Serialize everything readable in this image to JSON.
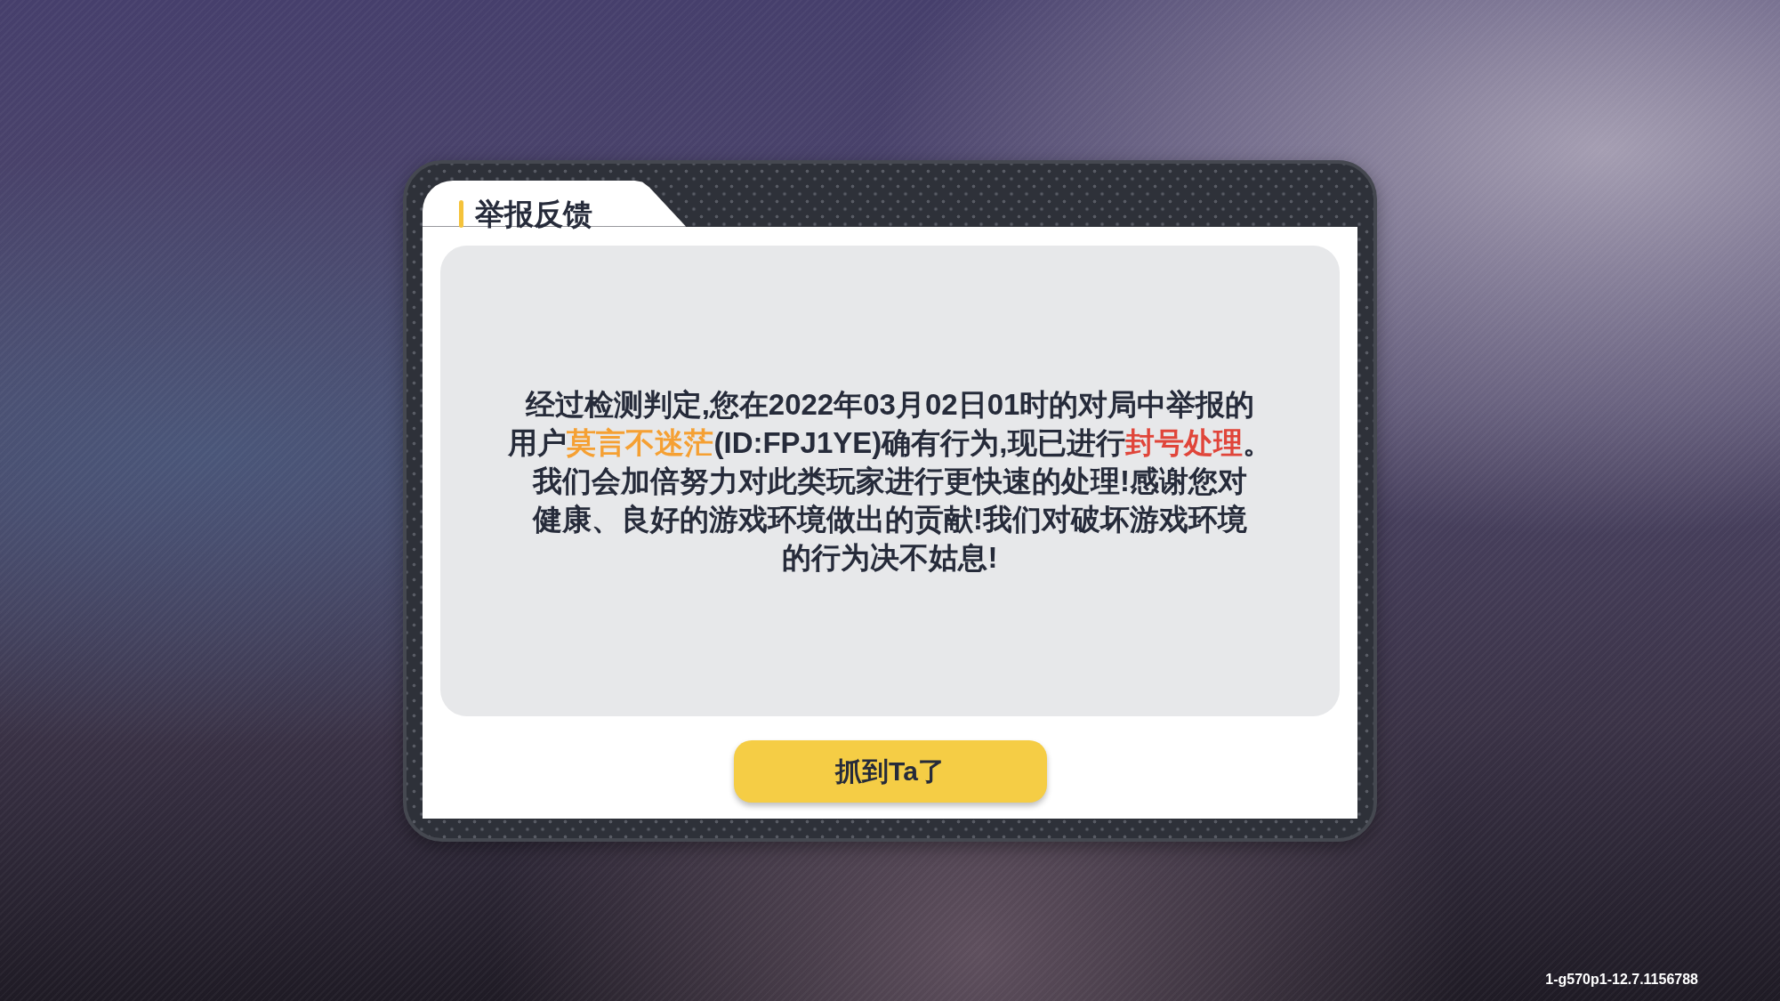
{
  "dialog": {
    "title": "举报反馈",
    "message_lines": [
      [
        {
          "kind": "plain",
          "text": "经过检测判定,您在2022年03月02日01时的对局中举报的"
        }
      ],
      [
        {
          "kind": "plain",
          "text": "用户"
        },
        {
          "kind": "player_name",
          "text": "莫言不迷茫"
        },
        {
          "kind": "plain",
          "text": "(ID:FPJ1YE)确有行为,现已进行"
        },
        {
          "kind": "penalty",
          "text": "封号处理"
        },
        {
          "kind": "plain",
          "text": "。"
        }
      ],
      [
        {
          "kind": "plain",
          "text": "我们会加倍努力对此类玩家进行更快速的处理!感谢您对"
        }
      ],
      [
        {
          "kind": "plain",
          "text": "健康、良好的游戏环境做出的贡献!我们对破坏游戏环境"
        }
      ],
      [
        {
          "kind": "plain",
          "text": "的行为决不姑息!"
        }
      ]
    ],
    "button": "抓到Ta了"
  },
  "version": "1-g570p1-12.7.1156788"
}
